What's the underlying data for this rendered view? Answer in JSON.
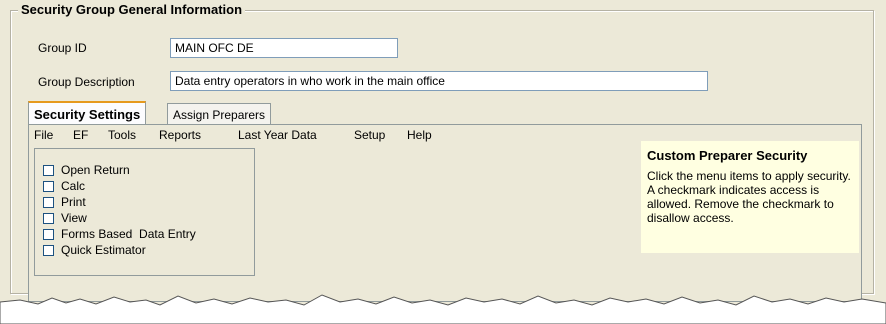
{
  "groupbox": {
    "title": "Security Group General Information"
  },
  "group_id": {
    "label": "Group ID",
    "value": "MAIN OFC DE"
  },
  "group_description": {
    "label": "Group Description",
    "value": "Data entry operators in who work in the main office"
  },
  "tabs": [
    {
      "label": "Security Settings",
      "active": true
    },
    {
      "label": "Assign Preparers",
      "active": false
    }
  ],
  "menu": [
    "File",
    "EF",
    "Tools",
    "Reports",
    "Last Year Data",
    "Setup",
    "Help"
  ],
  "checklist": [
    {
      "label": "Open Return",
      "checked": false
    },
    {
      "label": "Calc",
      "checked": false
    },
    {
      "label": "Print",
      "checked": false
    },
    {
      "label": "View",
      "checked": false
    },
    {
      "label": "Forms Based  Data Entry",
      "checked": false
    },
    {
      "label": "Quick Estimator",
      "checked": false
    }
  ],
  "help": {
    "title": "Custom Preparer Security",
    "text": "Click the menu items to apply security. A checkmark indicates access is allowed. Remove the checkmark to disallow access."
  },
  "colors": {
    "background": "#ece9d8",
    "help_bg": "#ffffe1",
    "tab_accent": "#e69a1d"
  }
}
